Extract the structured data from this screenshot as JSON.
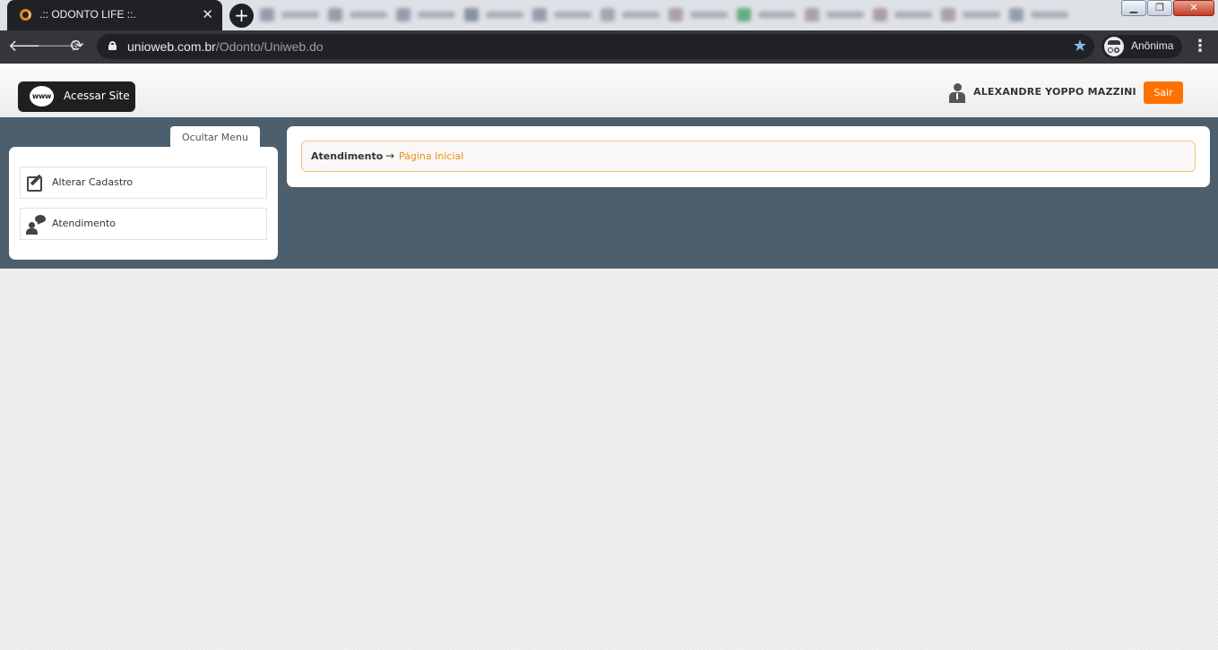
{
  "browser": {
    "active_tab_title": ".:: ODONTO LIFE ::.",
    "url_host": "unioweb.com.br",
    "url_path": "/Odonto/Uniweb.do",
    "profile_label": "Anônima",
    "background_tab_favicon_colors": [
      "#7a8796",
      "#7a8796",
      "#7a8796",
      "#6b7886",
      "#7a8796",
      "#8b96a3",
      "#9a8a8a",
      "#3d9a5f",
      "#9a8a8a",
      "#9a8a8a",
      "#9a8a8a",
      "#7a8796"
    ]
  },
  "header": {
    "site_button_label": "Acessar Site",
    "www_label": "www",
    "user_name": "ALEXANDRE YOPPO MAZZINI",
    "logout_label": "Sair"
  },
  "sidebar": {
    "toggle_label": "Ocultar Menu",
    "items": [
      {
        "label": "Alterar Cadastro",
        "icon": "edit-icon"
      },
      {
        "label": "Atendimento",
        "icon": "chat-user-icon"
      }
    ]
  },
  "breadcrumb": {
    "root": "Atendimento",
    "separator": "→",
    "current": "Página Inicial"
  },
  "colors": {
    "accent": "#ff7200",
    "breadcrumb_link": "#e8901a",
    "band": "#4d5f6d"
  }
}
